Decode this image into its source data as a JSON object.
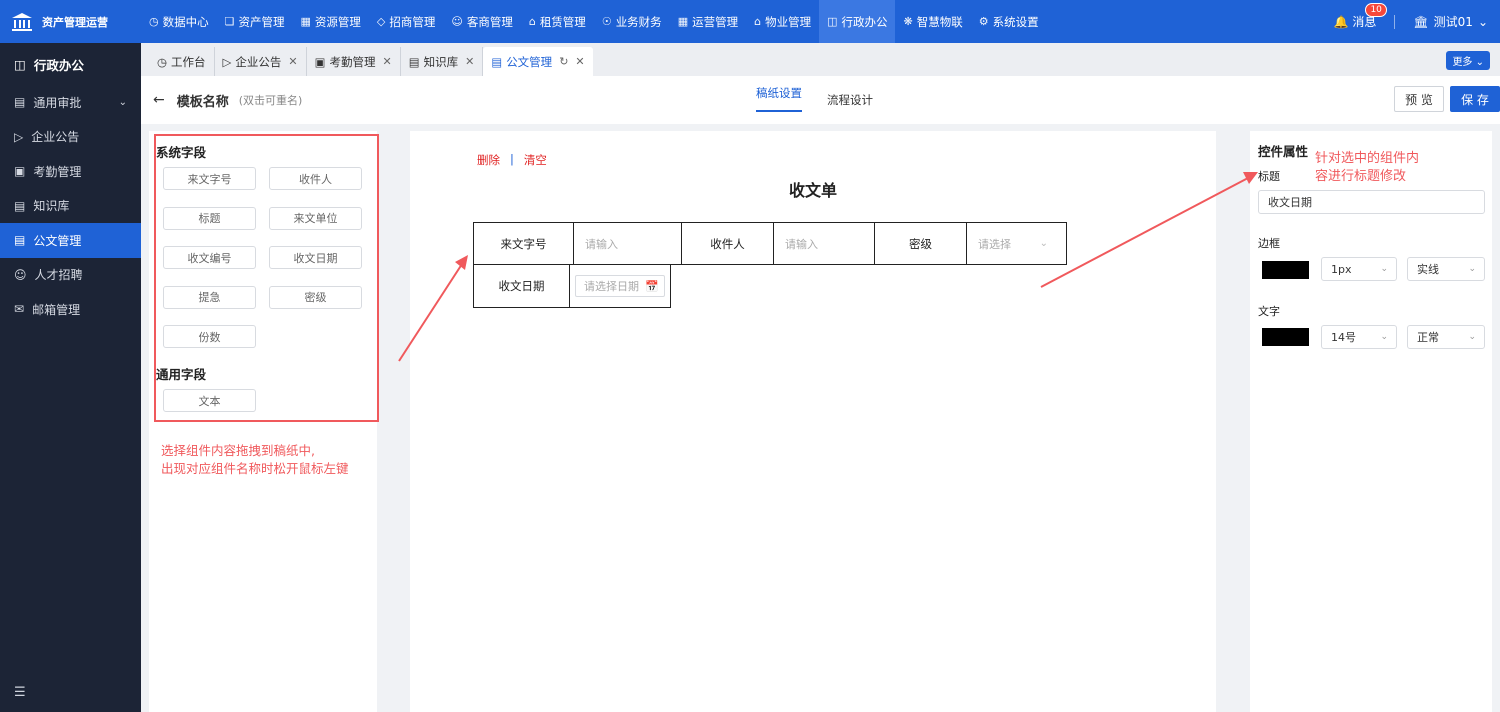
{
  "app": {
    "name": "资产管理运营"
  },
  "topnav": [
    {
      "label": "数据中心",
      "icon": "clock-icon"
    },
    {
      "label": "资产管理",
      "icon": "cube-icon"
    },
    {
      "label": "资源管理",
      "icon": "building-icon"
    },
    {
      "label": "招商管理",
      "icon": "tag-icon"
    },
    {
      "label": "客商管理",
      "icon": "people-icon"
    },
    {
      "label": "租赁管理",
      "icon": "house-icon"
    },
    {
      "label": "业务财务",
      "icon": "coin-icon"
    },
    {
      "label": "运营管理",
      "icon": "grid-icon"
    },
    {
      "label": "物业管理",
      "icon": "home-icon"
    },
    {
      "label": "行政办公",
      "icon": "monitor-icon",
      "active": true
    },
    {
      "label": "智慧物联",
      "icon": "atom-icon"
    },
    {
      "label": "系统设置",
      "icon": "gear-icon"
    }
  ],
  "header_right": {
    "messages_label": "消息",
    "messages_count": "10",
    "user_label": "测试01"
  },
  "sidebar": {
    "title": "行政办公",
    "items": [
      {
        "label": "通用审批",
        "has_children": true
      },
      {
        "label": "企业公告"
      },
      {
        "label": "考勤管理"
      },
      {
        "label": "知识库"
      },
      {
        "label": "公文管理",
        "active": true
      },
      {
        "label": "人才招聘"
      },
      {
        "label": "邮箱管理"
      }
    ]
  },
  "tabs": [
    {
      "label": "工作台",
      "closable": false
    },
    {
      "label": "企业公告",
      "closable": true
    },
    {
      "label": "考勤管理",
      "closable": true
    },
    {
      "label": "知识库",
      "closable": true
    },
    {
      "label": "公文管理",
      "closable": true,
      "active": true
    }
  ],
  "more_label": "更多",
  "page_header": {
    "title": "模板名称",
    "hint": "(双击可重名)",
    "center_tabs": [
      "稿纸设置",
      "流程设计"
    ],
    "active_center_tab": 0,
    "preview_label": "预 览",
    "save_label": "保 存"
  },
  "left_panel": {
    "system_title": "系统字段",
    "system_fields": [
      "来文字号",
      "收件人",
      "标题",
      "来文单位",
      "收文编号",
      "收文日期",
      "提急",
      "密级",
      "份数"
    ],
    "common_title": "通用字段",
    "common_fields": [
      "文本"
    ],
    "note": "选择组件内容拖拽到稿纸中,\n出现对应组件名称时松开鼠标左键"
  },
  "canvas": {
    "delete_label": "删除",
    "separator": "|",
    "clear_label": "清空",
    "doc_title": "收文单",
    "row1": [
      {
        "label": "来文字号",
        "placeholder": "请输入"
      },
      {
        "label": "收件人",
        "placeholder": "请输入"
      },
      {
        "label": "密级",
        "placeholder": "请选择"
      }
    ],
    "row2": [
      {
        "label": "收文日期",
        "placeholder": "请选择日期"
      }
    ]
  },
  "right_panel": {
    "title": "控件属性",
    "title_label": "标题",
    "title_value": "收文日期",
    "border_label": "边框",
    "border_color": "#000000",
    "border_width": "1px",
    "border_style": "实线",
    "text_label": "文字",
    "text_color": "#000000",
    "font_size": "14号",
    "font_weight": "正常",
    "annotation": "针对选中的组件内\n容进行标题修改"
  },
  "colors": {
    "primary": "#1f62d6",
    "sidebar_bg": "#1c2436",
    "annotation": "#f0595c"
  }
}
